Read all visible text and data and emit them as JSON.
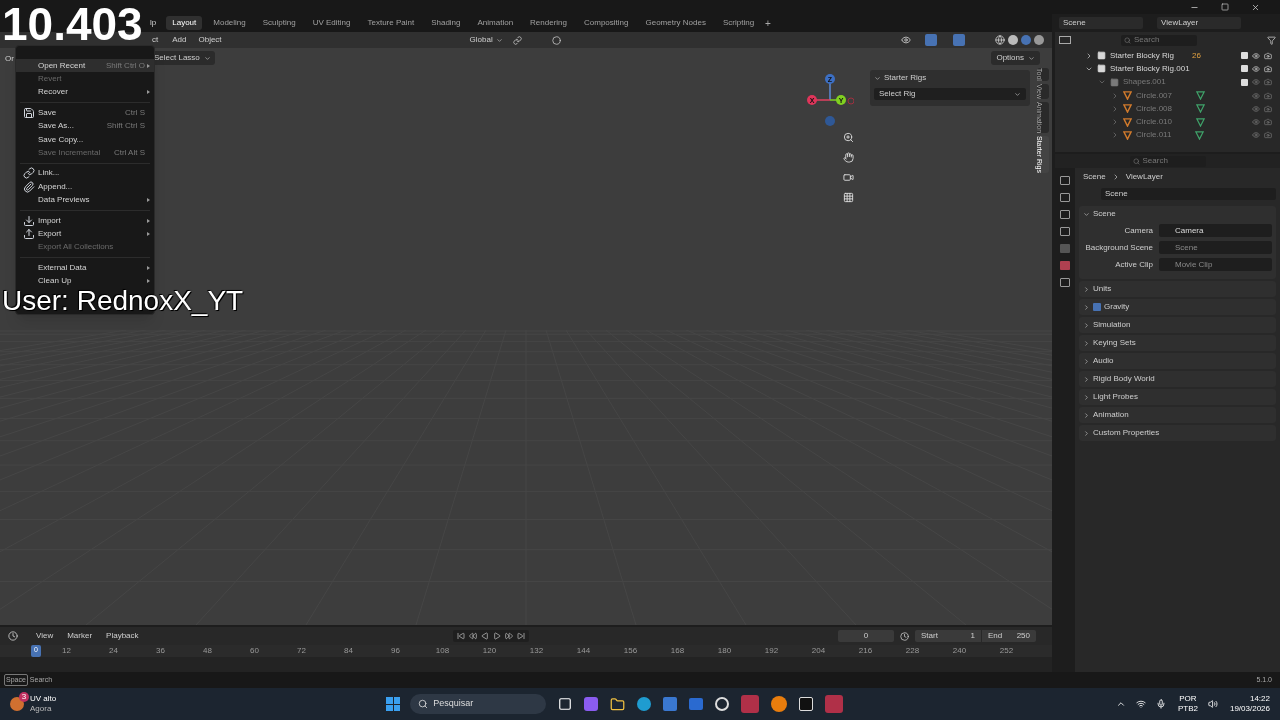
{
  "overlay": {
    "timer": "10.403",
    "user": "User: RednoxX_YT"
  },
  "top_bar": {
    "menu_fragment": "lp",
    "add_tab": "+"
  },
  "workspace_tabs": [
    {
      "label": "Layout",
      "selected": true
    },
    {
      "label": "Modeling",
      "selected": false
    },
    {
      "label": "Sculpting",
      "selected": false
    },
    {
      "label": "UV Editing",
      "selected": false
    },
    {
      "label": "Texture Paint",
      "selected": false
    },
    {
      "label": "Shading",
      "selected": false
    },
    {
      "label": "Animation",
      "selected": false
    },
    {
      "label": "Rendering",
      "selected": false
    },
    {
      "label": "Compositing",
      "selected": false
    },
    {
      "label": "Geometry Nodes",
      "selected": false
    },
    {
      "label": "Scripting",
      "selected": false
    }
  ],
  "viewport_header": {
    "menu_fragment": "ct",
    "menus": [
      "Add",
      "Object"
    ],
    "orientation": "Global",
    "options": "Options",
    "mode_fragment": "Or",
    "select_tool": "Select Lasso"
  },
  "file_menu": [
    {
      "kind": "item",
      "label": "Open Recent",
      "shortcut": "Shift Ctrl O",
      "submenu": true,
      "disabled": false,
      "highlighted": true
    },
    {
      "kind": "item",
      "label": "Revert",
      "disabled": true,
      "highlighted": false
    },
    {
      "kind": "item",
      "label": "Recover",
      "submenu": true,
      "disabled": false,
      "highlighted": false
    },
    {
      "kind": "separator"
    },
    {
      "kind": "item",
      "label": "Save",
      "shortcut": "Ctrl S",
      "disabled": false,
      "highlighted": false
    },
    {
      "kind": "item",
      "label": "Save As...",
      "shortcut": "Shift Ctrl S",
      "disabled": false,
      "highlighted": false
    },
    {
      "kind": "item",
      "label": "Save Copy...",
      "disabled": false,
      "highlighted": false
    },
    {
      "kind": "item",
      "label": "Save Incremental",
      "shortcut": "Ctrl Alt S",
      "disabled": true,
      "highlighted": false
    },
    {
      "kind": "separator"
    },
    {
      "kind": "item",
      "label": "Link...",
      "disabled": false,
      "highlighted": false
    },
    {
      "kind": "item",
      "label": "Append...",
      "disabled": false,
      "highlighted": false
    },
    {
      "kind": "item",
      "label": "Data Previews",
      "submenu": true,
      "disabled": false,
      "highlighted": false
    },
    {
      "kind": "separator"
    },
    {
      "kind": "item",
      "label": "Import",
      "submenu": true,
      "disabled": false,
      "highlighted": false
    },
    {
      "kind": "item",
      "label": "Export",
      "submenu": true,
      "disabled": false,
      "highlighted": false
    },
    {
      "kind": "item",
      "label": "Export All Collections",
      "disabled": true,
      "highlighted": false
    },
    {
      "kind": "separator"
    },
    {
      "kind": "item",
      "label": "External Data",
      "submenu": true,
      "disabled": false,
      "highlighted": false
    },
    {
      "kind": "item",
      "label": "Clean Up",
      "submenu": true,
      "disabled": false,
      "highlighted": false
    }
  ],
  "gizmo": {
    "x": "X",
    "y": "Y",
    "z": "Z"
  },
  "sidebar_panel": {
    "title": "Starter Rigs",
    "dropdown": "Select Rig"
  },
  "sidebar_tabs": [
    {
      "label": "Tool",
      "selected": false
    },
    {
      "label": "View",
      "selected": false
    },
    {
      "label": "Animation",
      "selected": false
    },
    {
      "label": "Starter Rigs",
      "selected": true
    }
  ],
  "outliner": {
    "scene": "Scene",
    "view_layer": "ViewLayer",
    "search_placeholder": "Search",
    "tree": [
      {
        "label": "Starter Blocky Rig",
        "kind": "collection",
        "badge": "26",
        "expanded": false,
        "dim": false
      },
      {
        "label": "Starter Blocky Rig.001",
        "kind": "collection",
        "expanded": true,
        "dim": false,
        "children": [
          {
            "label": "Shapes.001",
            "kind": "collection",
            "expanded": true,
            "dim": true,
            "children": [
              {
                "label": "Circle.007",
                "kind": "object",
                "expanded": false,
                "dim": true
              },
              {
                "label": "Circle.008",
                "kind": "object",
                "expanded": false,
                "dim": true
              },
              {
                "label": "Circle.010",
                "kind": "object",
                "expanded": false,
                "dim": true
              },
              {
                "label": "Circle.011",
                "kind": "object",
                "expanded": false,
                "dim": true
              }
            ]
          }
        ]
      }
    ]
  },
  "properties": {
    "search_placeholder": "Search",
    "breadcrumb": [
      "Scene",
      "ViewLayer"
    ],
    "scene_field": "Scene",
    "scene_panel": {
      "title": "Scene",
      "expanded": true,
      "fields": [
        {
          "label": "Camera",
          "value": "Camera"
        },
        {
          "label": "Background Scene",
          "placeholder": "Scene"
        },
        {
          "label": "Active Clip",
          "placeholder": "Movie Clip"
        }
      ]
    },
    "panels": [
      {
        "title": "Units",
        "kind": "plain"
      },
      {
        "title": "Gravity",
        "kind": "checkbox",
        "checked": true
      },
      {
        "title": "Simulation",
        "kind": "plain"
      },
      {
        "title": "Keying Sets",
        "kind": "plain"
      },
      {
        "title": "Audio",
        "kind": "plain"
      },
      {
        "title": "Rigid Body World",
        "kind": "plain"
      },
      {
        "title": "Light Probes",
        "kind": "plain"
      },
      {
        "title": "Animation",
        "kind": "plain"
      },
      {
        "title": "Custom Properties",
        "kind": "plain"
      }
    ]
  },
  "timeline": {
    "menus": [
      "View",
      "Marker",
      "Playback"
    ],
    "current_frame": "0",
    "start_label": "Start",
    "start": "1",
    "end_label": "End",
    "end": "250",
    "playhead": "0",
    "ticks": [
      "12",
      "24",
      "36",
      "48",
      "60",
      "72",
      "84",
      "96",
      "108",
      "120",
      "132",
      "144",
      "156",
      "168",
      "180",
      "192",
      "204",
      "216",
      "228",
      "240",
      "252"
    ]
  },
  "status_bar": {
    "key": "Space",
    "action": "Search",
    "version": "5.1.0"
  },
  "taskbar": {
    "notification_title": "UV alto",
    "notification_sub": "Agora",
    "notification_count": "3",
    "search_placeholder": "Pesquisar",
    "lang": "POR",
    "layout": "PTB2",
    "time": "14:22",
    "date": "19/03/2026"
  }
}
